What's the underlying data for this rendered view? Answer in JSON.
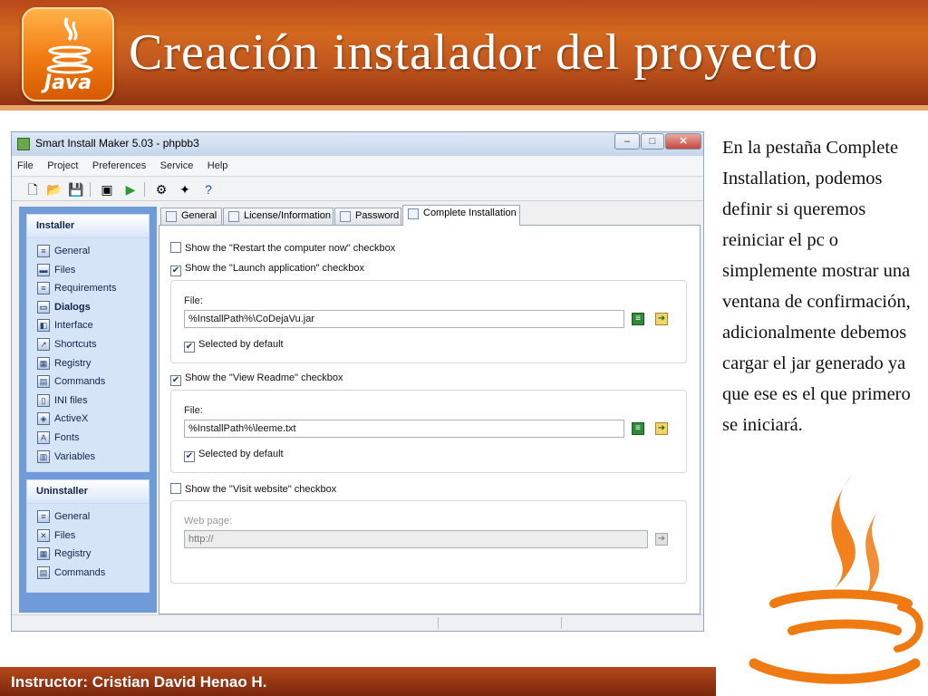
{
  "slide": {
    "title": "Creación instalador del proyecto",
    "logo_text": "Java",
    "footer": "Instructor: Cristian David Henao H.",
    "description": "En la pestaña Complete Installation, podemos definir si queremos reiniciar el pc o simplemente mostrar una ventana de confirmación, adicionalmente debemos cargar el jar generado ya que ese es el que primero se iniciará."
  },
  "window": {
    "title": "Smart Install Maker 5.03 - phpbb3",
    "controls": {
      "minimize": "–",
      "maximize": "□",
      "close": "✕"
    }
  },
  "menu": [
    "File",
    "Project",
    "Preferences",
    "Service",
    "Help"
  ],
  "toolbar": {
    "icons": [
      "new-file-icon",
      "open-folder-icon",
      "save-icon",
      "build-icon",
      "run-icon",
      "settings-icon",
      "wizard-icon",
      "help-icon"
    ]
  },
  "sidebar": {
    "installer": {
      "header": "Installer",
      "items": [
        "General",
        "Files",
        "Requirements",
        "Dialogs",
        "Interface",
        "Shortcuts",
        "Registry",
        "Commands",
        "INI files",
        "ActiveX",
        "Fonts",
        "Variables"
      ],
      "active": "Dialogs"
    },
    "uninstaller": {
      "header": "Uninstaller",
      "items": [
        "General",
        "Files",
        "Registry",
        "Commands"
      ]
    }
  },
  "tabs": [
    "General",
    "License/Information",
    "Password",
    "Complete Installation"
  ],
  "active_tab": "Complete Installation",
  "options": {
    "restart": {
      "label": "Show the \"Restart the computer now\" checkbox",
      "checked": false
    },
    "launch": {
      "label": "Show the \"Launch application\" checkbox",
      "checked": true,
      "file_label": "File:",
      "file_value": "%InstallPath%\\CoDejaVu.jar",
      "selected_label": "Selected by default",
      "selected": true
    },
    "readme": {
      "label": "Show the \"View Readme\" checkbox",
      "checked": true,
      "file_label": "File:",
      "file_value": "%InstallPath%\\leeme.txt",
      "selected_label": "Selected by default",
      "selected": true
    },
    "website": {
      "label": "Show the \"Visit website\" checkbox",
      "checked": false,
      "page_label": "Web page:",
      "page_value": "http://"
    }
  },
  "check_glyph": "✔",
  "colors": {
    "header_orange": "#c0561d",
    "sidebar_blue": "#6f9bd8",
    "java_orange": "#f07a12"
  }
}
